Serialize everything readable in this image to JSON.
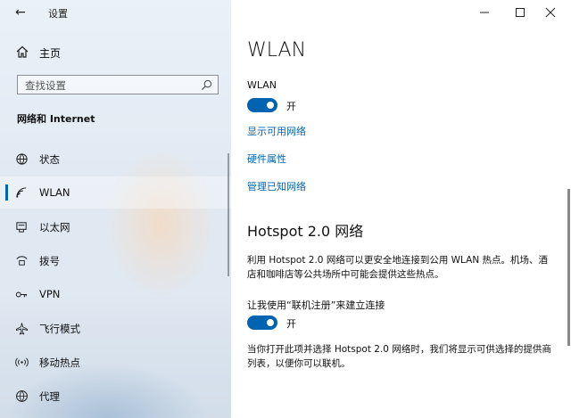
{
  "window": {
    "back_label": "←",
    "app_title": "设置"
  },
  "sidebar": {
    "home_label": "主页",
    "search_placeholder": "查找设置",
    "section_title": "网络和 Internet",
    "items": [
      {
        "label": "状态",
        "icon": "status-icon"
      },
      {
        "label": "WLAN",
        "icon": "wifi-icon",
        "selected": true
      },
      {
        "label": "以太网",
        "icon": "ethernet-icon"
      },
      {
        "label": "拨号",
        "icon": "dialup-icon"
      },
      {
        "label": "VPN",
        "icon": "vpn-icon"
      },
      {
        "label": "飞行模式",
        "icon": "airplane-icon"
      },
      {
        "label": "移动热点",
        "icon": "hotspot-icon"
      },
      {
        "label": "代理",
        "icon": "globe-icon"
      }
    ]
  },
  "main": {
    "title": "WLAN",
    "wlan_label": "WLAN",
    "wlan_toggle_state": "开",
    "links": [
      "显示可用网络",
      "硬件属性",
      "管理已知网络"
    ],
    "hotspot_title": "Hotspot 2.0 网络",
    "hotspot_desc": "利用 Hotspot 2.0 网络可以更安全地连接到公用 WLAN 热点。机场、酒店和咖啡店等公共场所中可能会提供这些热点。",
    "signup_label": "让我使用“联机注册”来建立连接",
    "signup_toggle_state": "开",
    "signup_desc": "当你打开此项并选择 Hotspot 2.0 网络时，我们将显示可供选择的提供商列表，以便你可以联机。"
  },
  "colors": {
    "accent": "#0063b1",
    "link": "#0063b1"
  }
}
